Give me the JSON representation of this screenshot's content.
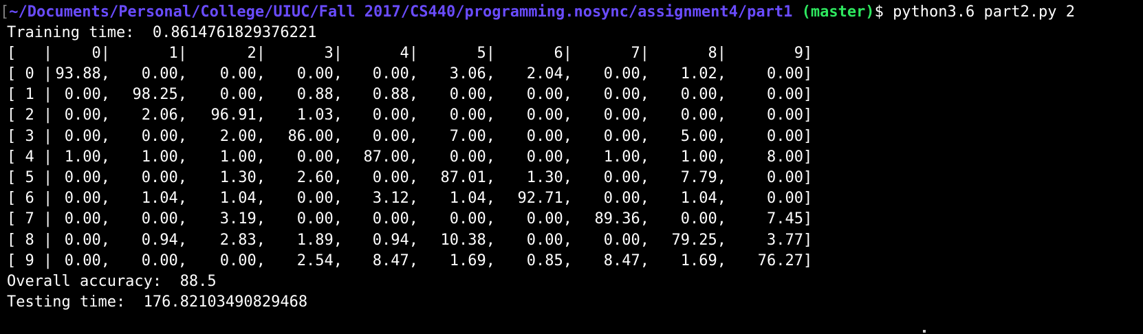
{
  "prompt": {
    "open_bracket": "[",
    "path": "~/Documents/Personal/College/UIUC/Fall 2017/CS440/programming.nosync/assignment4/part1",
    "branch": "(master)",
    "symbol": "$",
    "command": "python3.6 part2.py 2"
  },
  "training_time_line": "Training time:  0.8614761829376221",
  "matrix": {
    "header_prefix": "[   |",
    "close": "]",
    "headers": [
      "0|",
      "1|",
      "2|",
      "3|",
      "4|",
      "5|",
      "6|",
      "7|",
      "8|",
      "9"
    ],
    "rows": [
      {
        "label": "[ 0 |",
        "cells": [
          "93.88,",
          "0.00,",
          "0.00,",
          "0.00,",
          "0.00,",
          "3.06,",
          "2.04,",
          "0.00,",
          "1.02,",
          "0.00"
        ]
      },
      {
        "label": "[ 1 |",
        "cells": [
          "0.00,",
          "98.25,",
          "0.00,",
          "0.88,",
          "0.88,",
          "0.00,",
          "0.00,",
          "0.00,",
          "0.00,",
          "0.00"
        ]
      },
      {
        "label": "[ 2 |",
        "cells": [
          "0.00,",
          "2.06,",
          "96.91,",
          "1.03,",
          "0.00,",
          "0.00,",
          "0.00,",
          "0.00,",
          "0.00,",
          "0.00"
        ]
      },
      {
        "label": "[ 3 |",
        "cells": [
          "0.00,",
          "0.00,",
          "2.00,",
          "86.00,",
          "0.00,",
          "7.00,",
          "0.00,",
          "0.00,",
          "5.00,",
          "0.00"
        ]
      },
      {
        "label": "[ 4 |",
        "cells": [
          "1.00,",
          "1.00,",
          "1.00,",
          "0.00,",
          "87.00,",
          "0.00,",
          "0.00,",
          "1.00,",
          "1.00,",
          "8.00"
        ]
      },
      {
        "label": "[ 5 |",
        "cells": [
          "0.00,",
          "0.00,",
          "1.30,",
          "2.60,",
          "0.00,",
          "87.01,",
          "1.30,",
          "0.00,",
          "7.79,",
          "0.00"
        ]
      },
      {
        "label": "[ 6 |",
        "cells": [
          "0.00,",
          "1.04,",
          "1.04,",
          "0.00,",
          "3.12,",
          "1.04,",
          "92.71,",
          "0.00,",
          "1.04,",
          "0.00"
        ]
      },
      {
        "label": "[ 7 |",
        "cells": [
          "0.00,",
          "0.00,",
          "3.19,",
          "0.00,",
          "0.00,",
          "0.00,",
          "0.00,",
          "89.36,",
          "0.00,",
          "7.45"
        ]
      },
      {
        "label": "[ 8 |",
        "cells": [
          "0.00,",
          "0.94,",
          "2.83,",
          "1.89,",
          "0.94,",
          "10.38,",
          "0.00,",
          "0.00,",
          "79.25,",
          "3.77"
        ]
      },
      {
        "label": "[ 9 |",
        "cells": [
          "0.00,",
          "0.00,",
          "0.00,",
          "2.54,",
          "8.47,",
          "1.69,",
          "0.85,",
          "8.47,",
          "1.69,",
          "76.27"
        ]
      }
    ]
  },
  "overall_accuracy_line": "Overall accuracy:  88.5",
  "testing_time_line": "Testing time:  176.82103490829468",
  "colors": {
    "background": "#000000",
    "text": "#ffffff",
    "path": "#6a4cff",
    "branch": "#2ee85f"
  }
}
